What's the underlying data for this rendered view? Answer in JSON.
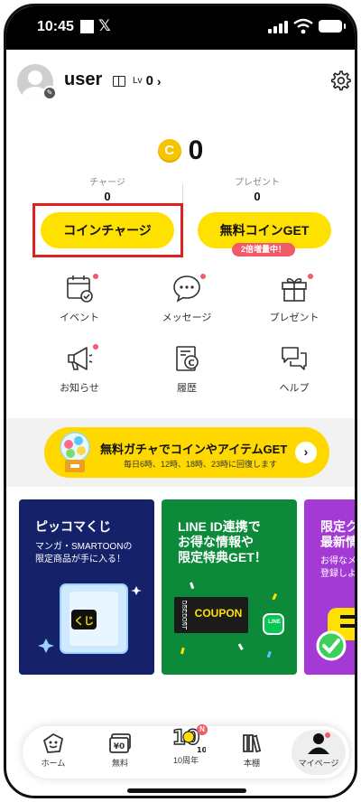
{
  "status_bar": {
    "time": "10:45",
    "app_letter": "𝕏"
  },
  "profile": {
    "username": "user",
    "level_label": "Lv",
    "level_value": "0"
  },
  "coins": {
    "coin_symbol": "C",
    "total": "0",
    "charge_label": "チャージ",
    "charge_value": "0",
    "present_label": "プレゼント",
    "present_value": "0"
  },
  "buttons": {
    "coin_charge": "コインチャージ",
    "free_coin": "無料コインGET",
    "free_badge": "2倍増量中！"
  },
  "menu": [
    {
      "label": "イベント",
      "icon": "calendar-icon",
      "dot": true
    },
    {
      "label": "メッセージ",
      "icon": "speech-bubble-icon",
      "dot": true
    },
    {
      "label": "プレゼント",
      "icon": "gift-icon",
      "dot": true
    },
    {
      "label": "お知らせ",
      "icon": "megaphone-icon",
      "dot": true
    },
    {
      "label": "履歴",
      "icon": "receipt-icon",
      "dot": false
    },
    {
      "label": "ヘルプ",
      "icon": "chat-bubbles-icon",
      "dot": false
    }
  ],
  "gacha_banner": {
    "title": "無料ガチャでコインやアイテムGET",
    "subtitle": "毎日6時、12時、18時、23時に回復します"
  },
  "promo_cards": [
    {
      "title": "ピッコマくじ",
      "subtitle_line1": "マンガ・SMARTOONの",
      "subtitle_line2": "限定商品が手に入る！",
      "badge": "くじ"
    },
    {
      "title_line1": "LINE ID連携で",
      "title_line2": "お得な情報や",
      "title_line3": "限定特典GET！",
      "coupon_tag": "DISCOUNT",
      "coupon_text": "COUPON",
      "line_badge": "LINE"
    },
    {
      "title_line1": "限定クー",
      "title_line2": "最新情報",
      "subtitle_line1": "お得なメ",
      "subtitle_line2": "登録しよ"
    }
  ],
  "bottom_nav": [
    {
      "label": "ホーム",
      "icon": "home-icon"
    },
    {
      "label": "無料",
      "icon": "free-ticket-icon"
    },
    {
      "label": "10周年",
      "icon": "anniversary-icon",
      "badge": "N",
      "mark": "10th"
    },
    {
      "label": "本棚",
      "icon": "bookshelf-icon"
    },
    {
      "label": "マイページ",
      "icon": "person-icon"
    }
  ],
  "colors": {
    "accent_yellow": "#ffe100",
    "highlight_red": "#e02020",
    "badge_pink": "#f05a6a"
  }
}
